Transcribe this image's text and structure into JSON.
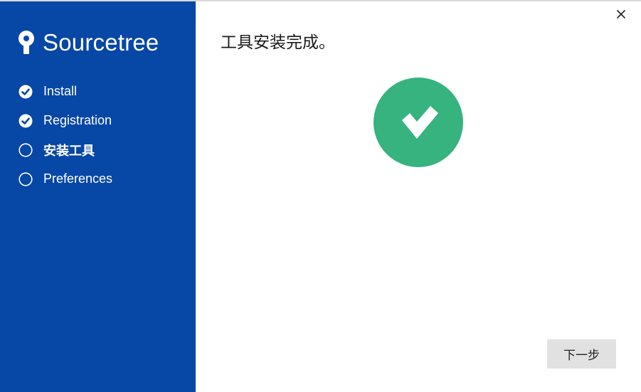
{
  "sidebar": {
    "brand": {
      "name": "Sourcetree",
      "logo_icon": "sourcetree-logo-icon"
    },
    "steps": [
      {
        "label": "Install",
        "status": "done",
        "icon": "check-circle-icon"
      },
      {
        "label": "Registration",
        "status": "done",
        "icon": "check-circle-icon"
      },
      {
        "label": "安装工具",
        "status": "current",
        "icon": "empty-circle-icon"
      },
      {
        "label": "Preferences",
        "status": "pending",
        "icon": "empty-circle-icon"
      }
    ],
    "background_color": "#0747a6"
  },
  "main": {
    "title": "工具安装完成。",
    "success_icon": "success-check-icon",
    "success_color": "#36b37e",
    "next_button_label": "下一步",
    "close_icon": "close-icon"
  }
}
